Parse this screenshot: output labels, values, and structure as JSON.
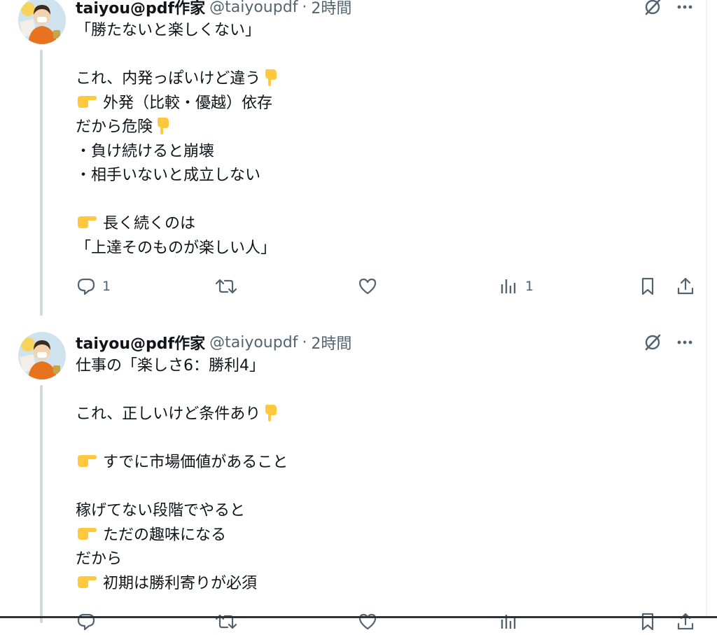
{
  "colors": {
    "text": "#0f1419",
    "secondary": "#536471",
    "thread_line": "#cfd9de"
  },
  "posts": [
    {
      "author_name": "taiyou@pdf作家",
      "handle": "@taiyoupdf",
      "separator": "·",
      "time": "2時間",
      "lines": [
        {
          "emoji_before": false,
          "text": "「勝たないと楽しくない」",
          "emoji_after": false
        },
        {
          "emoji_before": false,
          "text": "",
          "emoji_after": false
        },
        {
          "emoji_before": false,
          "text": "これ、内発っぽいけど違う",
          "emoji_after": true
        },
        {
          "emoji_before": true,
          "text": "外発（比較・優越）依存",
          "emoji_after": false
        },
        {
          "emoji_before": false,
          "text": "だから危険",
          "emoji_after": true
        },
        {
          "emoji_before": false,
          "text": "・負け続けると崩壊",
          "emoji_after": false
        },
        {
          "emoji_before": false,
          "text": "・相手いないと成立しない",
          "emoji_after": false
        },
        {
          "emoji_before": false,
          "text": "",
          "emoji_after": false
        },
        {
          "emoji_before": true,
          "text": "長く続くのは",
          "emoji_after": false
        },
        {
          "emoji_before": false,
          "text": "「上達そのものが楽しい人」",
          "emoji_after": false
        }
      ],
      "stats": {
        "replies": "1",
        "reposts": "",
        "likes": "",
        "views": "1"
      },
      "icons": [
        "grok-icon",
        "more-icon",
        "reply-icon",
        "repost-icon",
        "like-icon",
        "views-icon",
        "bookmark-icon",
        "share-icon"
      ]
    },
    {
      "author_name": "taiyou@pdf作家",
      "handle": "@taiyoupdf",
      "separator": "·",
      "time": "2時間",
      "lines": [
        {
          "emoji_before": false,
          "text": "仕事の「楽しさ6：勝利4」",
          "emoji_after": false
        },
        {
          "emoji_before": false,
          "text": "",
          "emoji_after": false
        },
        {
          "emoji_before": false,
          "text": "これ、正しいけど条件あり",
          "emoji_after": true
        },
        {
          "emoji_before": false,
          "text": "",
          "emoji_after": false
        },
        {
          "emoji_before": true,
          "text": "すでに市場価値があること",
          "emoji_after": false
        },
        {
          "emoji_before": false,
          "text": "",
          "emoji_after": false
        },
        {
          "emoji_before": false,
          "text": "稼げてない段階でやると",
          "emoji_after": false
        },
        {
          "emoji_before": true,
          "text": "ただの趣味になる",
          "emoji_after": false
        },
        {
          "emoji_before": false,
          "text": "だから",
          "emoji_after": false
        },
        {
          "emoji_before": true,
          "text": "初期は勝利寄りが必須",
          "emoji_after": false
        }
      ],
      "stats": {
        "replies": "",
        "reposts": "",
        "likes": "",
        "views": ""
      },
      "icons": [
        "grok-icon",
        "more-icon",
        "reply-icon",
        "repost-icon",
        "like-icon",
        "views-icon",
        "bookmark-icon",
        "share-icon"
      ]
    }
  ]
}
